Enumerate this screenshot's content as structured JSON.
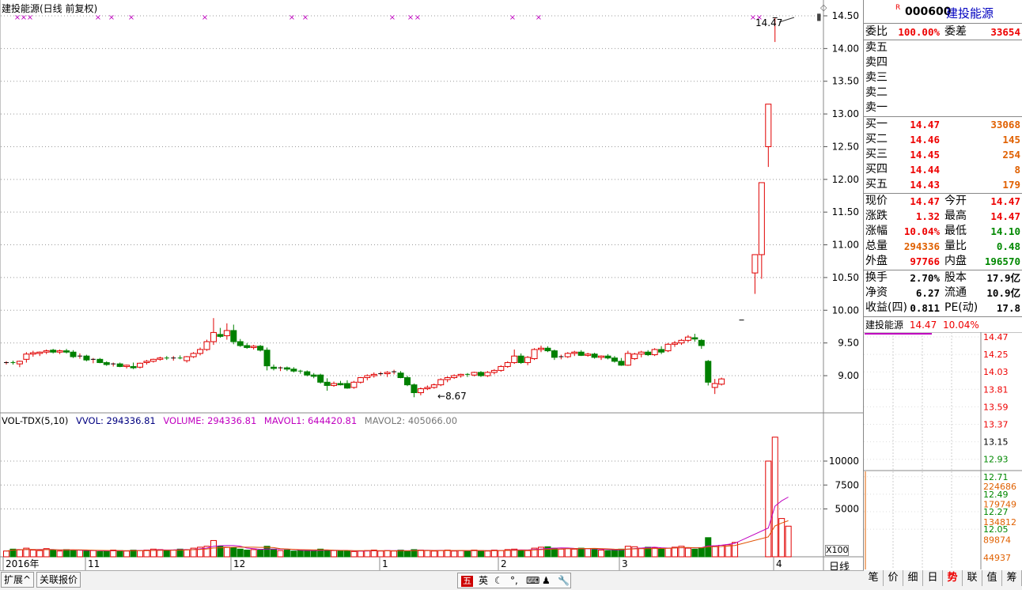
{
  "title": "建投能源(日线 前复权)",
  "last_price_label": "14.47",
  "low_label": "8.67",
  "price_axis": [
    "14.50",
    "14.00",
    "13.50",
    "13.00",
    "12.50",
    "12.00",
    "11.50",
    "11.00",
    "10.50",
    "10.00",
    "9.50",
    "9.00"
  ],
  "vol_header": {
    "name": "VOL-TDX(5,10)",
    "vvol": "VVOL: 294336.81",
    "volume": "VOLUME: 294336.81",
    "mavol1": "MAVOL1: 644420.81",
    "mavol2": "MAVOL2: 405066.00"
  },
  "vol_axis": [
    "10000",
    "7500",
    "5000"
  ],
  "vol_unit": "X100",
  "x_labels": [
    "2016年",
    "11",
    "12",
    "1",
    "2",
    "3",
    "4"
  ],
  "period_label": "日线",
  "quote": {
    "code_prefix": "R",
    "code": "000600",
    "name": "建投能源",
    "weibi_label": "委比",
    "weibi": "100.00%",
    "weicha_label": "委差",
    "weicha": "33654",
    "sell": [
      {
        "label": "卖五"
      },
      {
        "label": "卖四"
      },
      {
        "label": "卖三"
      },
      {
        "label": "卖二"
      },
      {
        "label": "卖一"
      }
    ],
    "buy": [
      {
        "label": "买一",
        "price": "14.47",
        "vol": "33068"
      },
      {
        "label": "买二",
        "price": "14.46",
        "vol": "145"
      },
      {
        "label": "买三",
        "price": "14.45",
        "vol": "254"
      },
      {
        "label": "买四",
        "price": "14.44",
        "vol": "8"
      },
      {
        "label": "买五",
        "price": "14.43",
        "vol": "179"
      }
    ],
    "stats": [
      {
        "l1": "现价",
        "v1": "14.47",
        "l2": "今开",
        "v2": "14.47"
      },
      {
        "l1": "涨跌",
        "v1": "1.32",
        "l2": "最高",
        "v2": "14.47"
      },
      {
        "l1": "涨幅",
        "v1": "10.04%",
        "l2": "最低",
        "v2": "14.10"
      },
      {
        "l1": "总量",
        "v1": "294336",
        "l2": "量比",
        "v2": "0.48"
      },
      {
        "l1": "外盘",
        "v1": "97766",
        "l2": "内盘",
        "v2": "196570"
      }
    ],
    "stats2": [
      {
        "l1": "换手",
        "v1": "2.70%",
        "l2": "股本",
        "v2": "17.9亿"
      },
      {
        "l1": "净资",
        "v1": "6.27",
        "l2": "流通",
        "v2": "10.9亿"
      },
      {
        "l1": "收益(四)",
        "v1": "0.811",
        "l2": "PE(动)",
        "v2": "17.8"
      }
    ]
  },
  "mini": {
    "name": "建投能源",
    "price": "14.47",
    "pct": "10.04%",
    "axis_red": [
      "14.47",
      "14.25",
      "14.03",
      "13.81",
      "13.59",
      "13.37"
    ],
    "axis_mid": "13.15",
    "axis_green": [
      "12.93",
      "12.71",
      "12.49",
      "12.27",
      "12.05"
    ],
    "vol_axis": [
      "224686",
      "179749",
      "134812",
      "89874",
      "44937"
    ]
  },
  "bottom_tabs": [
    "扩展^",
    "关联报价"
  ],
  "ime": {
    "mode": "五",
    "lang": "英"
  },
  "right_tabs": [
    "笔",
    "价",
    "细",
    "日",
    "势",
    "联",
    "值",
    "筹"
  ],
  "colors": {
    "up": "#e00000",
    "down": "#008000",
    "ma1": "#c000c0",
    "ma2": "#e05000",
    "purple": "#c000c0"
  },
  "chart_data": {
    "type": "candlestick",
    "title": "建投能源(日线 前复权)",
    "ylim": [
      8.5,
      14.6
    ],
    "candles": [
      [
        9.2,
        9.22,
        9.17,
        9.2
      ],
      [
        9.2,
        9.23,
        9.17,
        9.19
      ],
      [
        9.18,
        9.23,
        9.13,
        9.22
      ],
      [
        9.25,
        9.36,
        9.2,
        9.33
      ],
      [
        9.33,
        9.38,
        9.29,
        9.35
      ],
      [
        9.34,
        9.37,
        9.3,
        9.36
      ],
      [
        9.36,
        9.4,
        9.33,
        9.38
      ],
      [
        9.39,
        9.41,
        9.34,
        9.36
      ],
      [
        9.36,
        9.4,
        9.33,
        9.38
      ],
      [
        9.38,
        9.41,
        9.34,
        9.36
      ],
      [
        9.36,
        9.39,
        9.27,
        9.29
      ],
      [
        9.29,
        9.34,
        9.26,
        9.3
      ],
      [
        9.3,
        9.32,
        9.22,
        9.24
      ],
      [
        9.24,
        9.27,
        9.19,
        9.25
      ],
      [
        9.25,
        9.27,
        9.19,
        9.2
      ],
      [
        9.2,
        9.22,
        9.15,
        9.17
      ],
      [
        9.17,
        9.2,
        9.14,
        9.18
      ],
      [
        9.18,
        9.2,
        9.13,
        9.14
      ],
      [
        9.14,
        9.17,
        9.11,
        9.16
      ],
      [
        9.14,
        9.2,
        9.1,
        9.12
      ],
      [
        9.13,
        9.2,
        9.11,
        9.19
      ],
      [
        9.2,
        9.24,
        9.17,
        9.22
      ],
      [
        9.22,
        9.26,
        9.2,
        9.25
      ],
      [
        9.25,
        9.29,
        9.23,
        9.27
      ],
      [
        9.27,
        9.3,
        9.24,
        9.26
      ],
      [
        9.26,
        9.3,
        9.23,
        9.27
      ],
      [
        9.27,
        9.31,
        9.25,
        9.26
      ],
      [
        9.23,
        9.3,
        9.2,
        9.29
      ],
      [
        9.29,
        9.36,
        9.27,
        9.34
      ],
      [
        9.34,
        9.43,
        9.31,
        9.4
      ],
      [
        9.4,
        9.55,
        9.38,
        9.52
      ],
      [
        9.52,
        9.88,
        9.47,
        9.66
      ],
      [
        9.63,
        9.73,
        9.58,
        9.6
      ],
      [
        9.61,
        9.8,
        9.55,
        9.69
      ],
      [
        9.69,
        9.78,
        9.48,
        9.52
      ],
      [
        9.52,
        9.56,
        9.44,
        9.46
      ],
      [
        9.46,
        9.5,
        9.41,
        9.43
      ],
      [
        9.43,
        9.47,
        9.4,
        9.45
      ],
      [
        9.45,
        9.47,
        9.37,
        9.39
      ],
      [
        9.39,
        9.43,
        9.08,
        9.15
      ],
      [
        9.13,
        9.17,
        9.08,
        9.11
      ],
      [
        9.11,
        9.14,
        9.07,
        9.12
      ],
      [
        9.12,
        9.14,
        9.07,
        9.1
      ],
      [
        9.1,
        9.13,
        9.05,
        9.07
      ],
      [
        9.07,
        9.09,
        9.03,
        9.06
      ],
      [
        9.06,
        9.08,
        8.99,
        9.01
      ],
      [
        9.01,
        9.04,
        8.96,
        8.99
      ],
      [
        9.01,
        9.03,
        8.88,
        8.9
      ],
      [
        8.9,
        8.96,
        8.77,
        8.85
      ],
      [
        8.85,
        8.91,
        8.83,
        8.88
      ],
      [
        8.88,
        8.92,
        8.85,
        8.86
      ],
      [
        8.88,
        8.93,
        8.8,
        8.81
      ],
      [
        8.82,
        8.92,
        8.8,
        8.9
      ],
      [
        8.9,
        8.98,
        8.88,
        8.97
      ],
      [
        8.97,
        9.02,
        8.93,
        9.0
      ],
      [
        9.0,
        9.05,
        8.97,
        9.02
      ],
      [
        9.02,
        9.06,
        9.0,
        9.03
      ],
      [
        9.03,
        9.07,
        8.98,
        9.05
      ],
      [
        9.05,
        9.09,
        9.02,
        9.06
      ],
      [
        9.04,
        9.07,
        8.96,
        8.97
      ],
      [
        8.97,
        9.0,
        8.84,
        8.86
      ],
      [
        8.86,
        8.88,
        8.67,
        8.74
      ],
      [
        8.74,
        8.82,
        8.7,
        8.8
      ],
      [
        8.8,
        8.85,
        8.78,
        8.82
      ],
      [
        8.82,
        8.88,
        8.8,
        8.86
      ],
      [
        8.86,
        8.96,
        8.84,
        8.94
      ],
      [
        8.94,
        8.99,
        8.9,
        8.97
      ],
      [
        8.97,
        9.02,
        8.95,
        9.0
      ],
      [
        9.0,
        9.03,
        8.97,
        9.02
      ],
      [
        9.02,
        9.04,
        8.98,
        9.01
      ],
      [
        9.01,
        9.06,
        8.99,
        9.05
      ],
      [
        9.05,
        9.07,
        8.98,
        9.0
      ],
      [
        9.0,
        9.07,
        8.98,
        9.05
      ],
      [
        9.05,
        9.1,
        9.02,
        9.08
      ],
      [
        9.08,
        9.16,
        9.06,
        9.14
      ],
      [
        9.14,
        9.22,
        9.12,
        9.2
      ],
      [
        9.2,
        9.4,
        9.18,
        9.3
      ],
      [
        9.3,
        9.34,
        9.18,
        9.2
      ],
      [
        9.2,
        9.3,
        9.16,
        9.28
      ],
      [
        9.26,
        9.42,
        9.24,
        9.4
      ],
      [
        9.4,
        9.46,
        9.36,
        9.42
      ],
      [
        9.42,
        9.45,
        9.36,
        9.38
      ],
      [
        9.38,
        9.4,
        9.24,
        9.28
      ],
      [
        9.28,
        9.32,
        9.25,
        9.29
      ],
      [
        9.29,
        9.36,
        9.27,
        9.34
      ],
      [
        9.34,
        9.38,
        9.3,
        9.36
      ],
      [
        9.36,
        9.39,
        9.3,
        9.31
      ],
      [
        9.31,
        9.35,
        9.29,
        9.33
      ],
      [
        9.33,
        9.35,
        9.26,
        9.28
      ],
      [
        9.28,
        9.31,
        9.24,
        9.3
      ],
      [
        9.3,
        9.33,
        9.25,
        9.27
      ],
      [
        9.27,
        9.3,
        9.2,
        9.22
      ],
      [
        9.22,
        9.27,
        9.15,
        9.16
      ],
      [
        9.16,
        9.38,
        9.15,
        9.34
      ],
      [
        9.26,
        9.35,
        9.24,
        9.33
      ],
      [
        9.33,
        9.38,
        9.28,
        9.36
      ],
      [
        9.36,
        9.39,
        9.3,
        9.32
      ],
      [
        9.32,
        9.42,
        9.3,
        9.4
      ],
      [
        9.4,
        9.45,
        9.33,
        9.36
      ],
      [
        9.38,
        9.5,
        9.36,
        9.48
      ],
      [
        9.48,
        9.53,
        9.44,
        9.5
      ],
      [
        9.5,
        9.56,
        9.47,
        9.54
      ],
      [
        9.54,
        9.62,
        9.51,
        9.59
      ],
      [
        9.58,
        9.64,
        9.52,
        9.56
      ],
      [
        9.54,
        9.56,
        9.41,
        9.46
      ],
      [
        9.22,
        9.24,
        8.85,
        8.9
      ],
      [
        8.82,
        8.95,
        8.72,
        8.88
      ],
      [
        8.87,
        8.97,
        8.85,
        8.95
      ],
      null,
      null,
      [
        9.85,
        9.85,
        9.85,
        9.85
      ],
      null,
      [
        10.57,
        10.85,
        10.25,
        10.85
      ],
      [
        10.85,
        11.95,
        10.48,
        11.95
      ],
      [
        12.5,
        13.15,
        12.19,
        13.15
      ],
      [
        14.47,
        14.47,
        14.1,
        14.47
      ]
    ],
    "volume_ylim": [
      0,
      12500
    ],
    "volumes": [
      600,
      800,
      750,
      900,
      700,
      650,
      850,
      700,
      600,
      750,
      650,
      700,
      600,
      650,
      550,
      600,
      700,
      650,
      600,
      700,
      650,
      700,
      800,
      750,
      650,
      700,
      800,
      750,
      900,
      1000,
      1100,
      1700,
      1100,
      1000,
      950,
      800,
      700,
      750,
      700,
      1100,
      800,
      650,
      700,
      600,
      650,
      700,
      600,
      800,
      700,
      650,
      600,
      600,
      550,
      600,
      650,
      700,
      600,
      650,
      600,
      700,
      600,
      750,
      700,
      650,
      600,
      650,
      700,
      600,
      650,
      600,
      700,
      650,
      600,
      700,
      650,
      750,
      800,
      700,
      650,
      900,
      1000,
      1050,
      900,
      800,
      850,
      800,
      900,
      850,
      750,
      700,
      650,
      700,
      800,
      1100,
      1050,
      900,
      1000,
      950,
      800,
      900,
      1000,
      1100,
      900,
      800,
      950,
      2000,
      1100,
      1200,
      1250,
      1500,
      null,
      null,
      null,
      null,
      10000,
      12500,
      4000,
      3200
    ],
    "vol_ma1_end": "644420.81",
    "vol_ma2_end": "405066.00"
  }
}
